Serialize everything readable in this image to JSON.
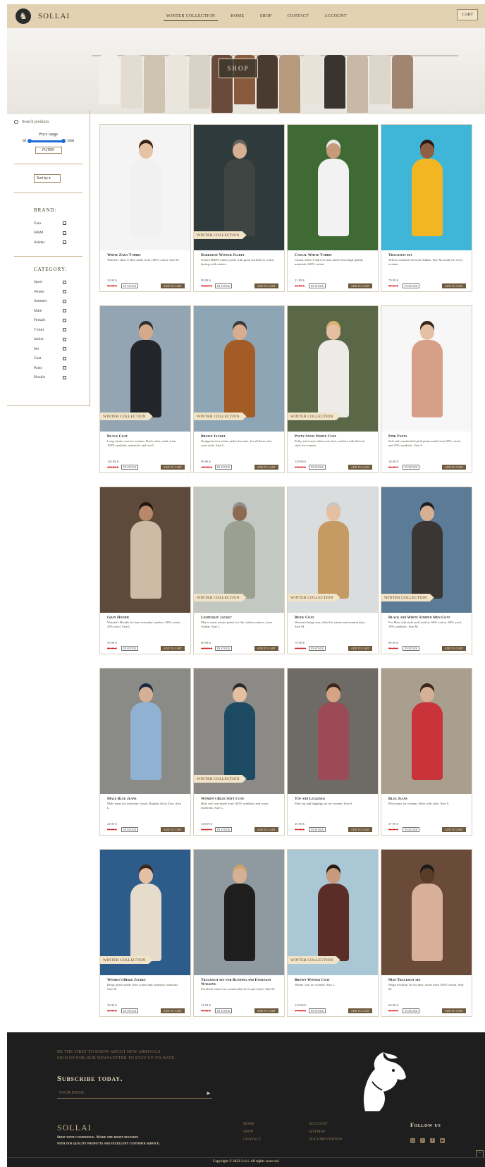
{
  "nav": {
    "brand": "SOLLAI",
    "links": [
      "WINTER COLLECTION",
      "HOME",
      "SHOP",
      "CONTACT",
      "ACCOUNT"
    ],
    "active": 0,
    "cart": "CART"
  },
  "hero": {
    "button": "SHOP"
  },
  "sidebar": {
    "search_placeholder": "Search products",
    "price_range": "Price range",
    "min": "0$",
    "max": "300$",
    "filter": "Filter",
    "sort": "Sort by",
    "brand_title": "Brand:",
    "brands": [
      "Zara",
      "H&M",
      "Adidas"
    ],
    "category_title": "Category:",
    "categories": [
      "Sport",
      "Winter",
      "Summer",
      "Male",
      "Female",
      "T-shirt",
      "Jacket",
      "Set",
      "Coat",
      "Pants",
      "Hoodie"
    ]
  },
  "products": [
    {
      "name": "White Zara T-shirt",
      "desc": "Women's short T-shirt made from 100% cotton. Size M.",
      "price": "19.99 $",
      "old": "35.99 $",
      "tag": "",
      "stock": "In stock",
      "add": "Add to cart",
      "skin": "#e7c3a6",
      "hair": "#3a2618",
      "top": "#f1f1f1",
      "bg": "#f4f4f4"
    },
    {
      "name": "Darkgray Winter Jacket",
      "desc": "Unisex H&M winter jacket with good warmth for warm during cold winters.",
      "price": "99.99 $",
      "old": "150.00 $",
      "tag": "WINTER COLLECTION",
      "stock": "In stock",
      "add": "Add to cart",
      "skin": "#d7b094",
      "hair": "#6b6660",
      "top": "#3f4542",
      "bg": "#2f3a3c"
    },
    {
      "name": "Casual White T-shirt",
      "desc": "Casual white T-shirt for men made from high-quality materials 100% cotton.",
      "price": "21.99 $",
      "old": "33.99 $",
      "tag": "",
      "stock": "In stock",
      "add": "Add to cart",
      "skin": "#c89a7c",
      "hair": "#e8e8e8",
      "top": "#f2f2f2",
      "bg": "#3f6a33"
    },
    {
      "name": "Tracksuit set",
      "desc": "Yellow tracksuit set from Adidas. Size M, made for every woman.",
      "price": "79.99 $",
      "old": "99.99 $",
      "tag": "",
      "stock": "In stock",
      "add": "Add to cart",
      "skin": "#8f5f43",
      "hair": "#2a1a10",
      "top": "#f2b623",
      "bg": "#3fb6d8"
    },
    {
      "name": "Black Coat",
      "desc": "Long winter coat for women, black color, made from 100% synthetic materials, and wool.",
      "price": "119.99 $",
      "old": "159.99 $",
      "tag": "WINTER COLLECTION",
      "stock": "In stock",
      "add": "Add to cart",
      "skin": "#d6a98a",
      "hair": "#2f2f2f",
      "top": "#22262a",
      "bg": "#93a4b3"
    },
    {
      "name": "Brown Jacket",
      "desc": "Orange-brown winter jacket for men, for all those who want style. Size L.",
      "price": "89.99 $",
      "old": "119.99 $",
      "tag": "WINTER COLLECTION",
      "stock": "In stock",
      "add": "Add to cart",
      "skin": "#d8ad8e",
      "hair": "#3b3b3b",
      "top": "#a35c25",
      "bg": "#8ea5b5"
    },
    {
      "name": "Puffy Snow White Coat",
      "desc": "Puffy and warm white coat, best comfort with the best style for women.",
      "price": "129.99 $",
      "old": "179.99 $",
      "tag": "WINTER COLLECTION",
      "stock": "In stock",
      "add": "Add to cart",
      "skin": "#e4bfa1",
      "hair": "#d8b26e",
      "top": "#ecebe7",
      "bg": "#5a6848"
    },
    {
      "name": "Pink Pants",
      "desc": "Soft and comfortable pink pants made from 90% cotton and 10% synthetic. Size S.",
      "price": "19.99 $",
      "old": "29.99 $",
      "tag": "",
      "stock": "In stock",
      "add": "Add to cart",
      "skin": "#e5c0a4",
      "hair": "#3a2618",
      "top": "#d89f88",
      "bg": "#f7f7f7"
    },
    {
      "name": "Gray Hoodie",
      "desc": "Women's Hoodie for best everyday comfort, 80% cotton, 20% wool. Size L.",
      "price": "39.99 $",
      "old": "59.99 $",
      "tag": "",
      "stock": "In stock",
      "add": "Add to cart",
      "skin": "#b9876a",
      "hair": "#1f1812",
      "top": "#cdbba6",
      "bg": "#5e4a3a"
    },
    {
      "name": "Lightgray Jacket",
      "desc": "Men's warm winter jacket for the coldest winters, from Adidas. Size L.",
      "price": "89.99 $",
      "old": "129.99 $",
      "tag": "WINTER COLLECTION",
      "stock": "In stock",
      "add": "Add to cart",
      "skin": "#8f6a52",
      "hair": "#8f8f8f",
      "top": "#9ba091",
      "bg": "#c4c8c3"
    },
    {
      "name": "Beige Coat",
      "desc": "Women's beige coat, ideal for winter and autumn days. Size M.",
      "price": "79.99 $",
      "old": "109.99 $",
      "tag": "WINTER COLLECTION",
      "stock": "In stock",
      "add": "Add to cart",
      "skin": "#e4bfa1",
      "hair": "#c8c5bd",
      "top": "#c69a63",
      "bg": "#d9ddde"
    },
    {
      "name": "Black and White Striped Men Coat",
      "desc": "For Men with style and comfort, 60% cotton, 30% wool, 10% synthetic. Size M.",
      "price": "69.99 $",
      "old": "89.99 $",
      "tag": "WINTER COLLECTION",
      "stock": "In stock",
      "add": "Add to cart",
      "skin": "#d6b095",
      "hair": "#1f1f1f",
      "top": "#3a3634",
      "bg": "#5b7b96"
    },
    {
      "name": "Male Blue Jeans",
      "desc": "Male jeans for everyday casual. Regular fit by Zara. Size L.",
      "price": "24.99 $",
      "old": "39.99 $",
      "tag": "",
      "stock": "In stock",
      "add": "Add to cart",
      "skin": "#d6b095",
      "hair": "#1c2a42",
      "top": "#8fb1d2",
      "bg": "#8a8a86"
    },
    {
      "name": "Women's Blue Soft Coat",
      "desc": "Blue soft coat made from 100% synthetic and warm materials. Size L.",
      "price": "149.99 $",
      "old": "199.99 $",
      "tag": "WINTER COLLECTION",
      "stock": "In stock",
      "add": "Add to cart",
      "skin": "#e4bfa1",
      "hair": "#2a2a2a",
      "top": "#1d4a63",
      "bg": "#8c8a86"
    },
    {
      "name": "Top and Leggings",
      "desc": "Pink top and leggings set for women. Size S.",
      "price": "49.99 $",
      "old": "69.99 $",
      "tag": "",
      "stock": "In stock",
      "add": "Add to cart",
      "skin": "#d6a384",
      "hair": "#3a2618",
      "top": "#9c4a55",
      "bg": "#6e6a66"
    },
    {
      "name": "Blue Jeans",
      "desc": "Blue jeans for women. Wear with style. Size S.",
      "price": "27.99 $",
      "old": "39.99 $",
      "tag": "",
      "stock": "In stock",
      "add": "Add to cart",
      "skin": "#d6b095",
      "hair": "#3a2618",
      "top": "#c9343a",
      "bg": "#a89f8e"
    },
    {
      "name": "Women's Beige Jacket",
      "desc": "Beige jacket made from cotton and synthetic materials. Size M.",
      "price": "39.99 $",
      "old": "59.99 $",
      "tag": "WINTER COLLECTION",
      "stock": "In stock",
      "add": "Add to cart",
      "skin": "#e4bfa1",
      "hair": "#3a2618",
      "top": "#e6dccb",
      "bg": "#2d5c8a"
    },
    {
      "name": "Tracksuit set for Running and Everyday Walking",
      "desc": "Excellent choice for women that love sport style. Size M.",
      "price": "74.99 $",
      "old": "99.99 $",
      "tag": "",
      "stock": "In stock",
      "add": "Add to cart",
      "skin": "#d6b095",
      "hair": "#c8a36a",
      "top": "#1e1e1e",
      "bg": "#8f9aa0"
    },
    {
      "name": "Brown Winter Coat",
      "desc": "Winter coat for women. Size L.",
      "price": "139.99 $",
      "old": "179.99 $",
      "tag": "WINTER COLLECTION",
      "stock": "In stock",
      "add": "Add to cart",
      "skin": "#c89a7c",
      "hair": "#2a1a10",
      "top": "#5a2d26",
      "bg": "#a9c7d5"
    },
    {
      "name": "Man Tracksuit set",
      "desc": "Beige tracksuit set for men, made from 100% cotton. Size M.",
      "price": "69.99 $",
      "old": "89.99 $",
      "tag": "",
      "stock": "In stock",
      "add": "Add to cart",
      "skin": "#5a3a28",
      "hair": "#1a1a1a",
      "top": "#d8b09a",
      "bg": "#6a4a38"
    }
  ],
  "footer": {
    "first_line1": "Be the first to know about new arrivals",
    "first_line2": "sign up for our newsletter to stay up-to-date.",
    "subscribe": "Subscribe today.",
    "email_placeholder": "Your Email",
    "brand": "SOLLAI",
    "tagline1": "Shop with confidence. Make the right decision",
    "tagline2": "with our quality products and excellent customer service.",
    "col1": [
      "Home",
      "Shop",
      "Contact"
    ],
    "col2": [
      "Account",
      "Sitemap",
      "Documentation"
    ],
    "follow": "Follow us",
    "copyright_pre": "Copyright © 2023",
    "copyright_brand": "Sollai",
    "copyright_post": ". All rights reserved."
  },
  "icons": [
    "horse-logo-icon",
    "search-icon",
    "send-icon",
    "instagram-icon",
    "twitter-icon",
    "facebook-icon",
    "youtube-icon",
    "arrow-up-icon"
  ]
}
